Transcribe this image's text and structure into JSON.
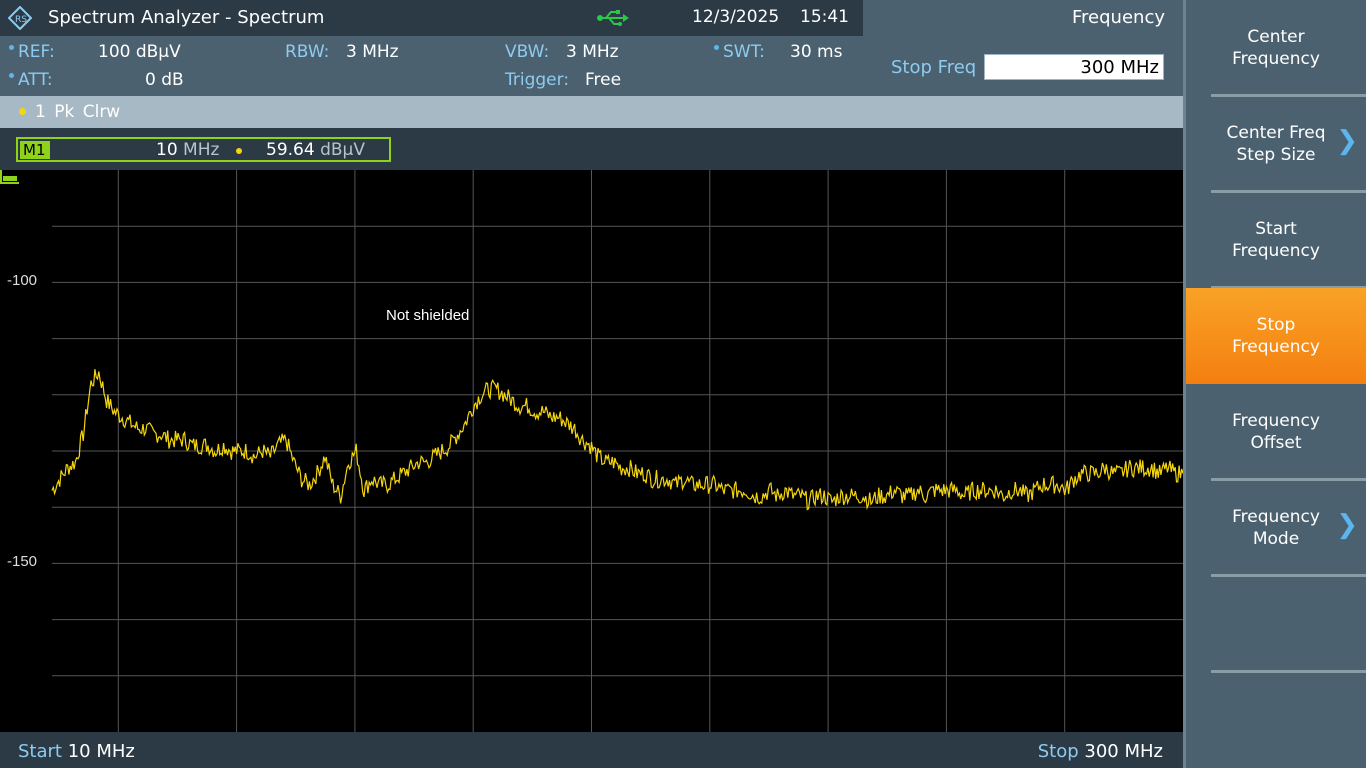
{
  "window": {
    "title": "Spectrum Analyzer - Spectrum",
    "date": "12/3/2025",
    "time": "15:41",
    "logo_icon": "rohde-schwarz-logo",
    "usb_icon": "usb-icon"
  },
  "params": {
    "ref_label": "REF:",
    "ref_value": "100 dBµV",
    "att_label": "ATT:",
    "att_value": "0 dB",
    "rbw_label": "RBW:",
    "rbw_value": "3 MHz",
    "vbw_label": "VBW:",
    "vbw_value": "3 MHz",
    "trigger_label": "Trigger:",
    "trigger_value": "Free",
    "swt_label": "SWT:",
    "swt_value": "30 ms"
  },
  "freq_panel": {
    "title": "Frequency",
    "field_label": "Stop Freq",
    "field_value": "300 MHz"
  },
  "trace": {
    "label": "1 Pk  Clrw",
    "color": "#f5d60a"
  },
  "marker": {
    "tag": "M1",
    "x_value": "10",
    "x_unit": "MHz",
    "y_value": "59.64",
    "y_unit": "dBµV",
    "color": "#8fd21a"
  },
  "plot": {
    "annotation": "Not shielded",
    "y_ticks": [
      "-100",
      "-150"
    ]
  },
  "status": {
    "start_label": "Start",
    "start_value": "10 MHz",
    "stop_label": "Stop",
    "stop_value": "300 MHz"
  },
  "softkeys": [
    {
      "label": "Center\nFrequency",
      "chevron": false,
      "active": false
    },
    {
      "label": "Center Freq\nStep Size",
      "chevron": true,
      "active": false
    },
    {
      "label": "Start\nFrequency",
      "chevron": false,
      "active": false
    },
    {
      "label": "Stop\nFrequency",
      "chevron": false,
      "active": true
    },
    {
      "label": "Frequency\nOffset",
      "chevron": false,
      "active": false
    },
    {
      "label": "Frequency\nMode",
      "chevron": true,
      "active": false
    }
  ],
  "chart_data": {
    "type": "line",
    "x_unit": "MHz",
    "xlim": [
      10,
      300
    ],
    "ylim": [
      -180,
      -80
    ],
    "y_unit": "dBµV",
    "y_ticks": [
      -100,
      -150
    ],
    "series": [
      {
        "color": "#f5d60a",
        "x": [
          10,
          12,
          14,
          16,
          18,
          20,
          22,
          24,
          26,
          28,
          30,
          32,
          34,
          36,
          38,
          40,
          42,
          44,
          46,
          48,
          50,
          52,
          54,
          56,
          58,
          60,
          62,
          64,
          66,
          68,
          70,
          72,
          74,
          76,
          78,
          80,
          82,
          84,
          86,
          88,
          90,
          92,
          94,
          96,
          98,
          100,
          102,
          104,
          106,
          108,
          110,
          112,
          114,
          116,
          118,
          120,
          122,
          124,
          126,
          128,
          130,
          132,
          134,
          136,
          138,
          140,
          142,
          144,
          146,
          148,
          150,
          152,
          154,
          156,
          158,
          160,
          162,
          164,
          166,
          168,
          170,
          172,
          174,
          176,
          178,
          180,
          182,
          184,
          186,
          188,
          190,
          192,
          194,
          196,
          198,
          200,
          202,
          204,
          206,
          208,
          210,
          212,
          214,
          216,
          218,
          220,
          222,
          224,
          226,
          228,
          230,
          232,
          234,
          236,
          238,
          240,
          242,
          244,
          246,
          248,
          250,
          252,
          254,
          256,
          258,
          260,
          262,
          264,
          266,
          268,
          270,
          272,
          274,
          276,
          278,
          280,
          282,
          284,
          286,
          288,
          290,
          292,
          294,
          296,
          298,
          300
        ],
        "y": [
          -137,
          -135,
          -133,
          -132,
          -127,
          -118,
          -116,
          -121,
          -123,
          -124,
          -125,
          -126,
          -126,
          -127,
          -127,
          -128,
          -128,
          -128,
          -129,
          -129,
          -129,
          -130,
          -129,
          -130,
          -130,
          -130,
          -131,
          -130,
          -131,
          -129,
          -128,
          -132,
          -135,
          -136,
          -134,
          -131,
          -136,
          -138,
          -132,
          -130,
          -137,
          -135,
          -136,
          -136,
          -135,
          -134,
          -133,
          -132,
          -132,
          -131,
          -130,
          -129,
          -127,
          -125,
          -122,
          -120,
          -119,
          -119,
          -120,
          -121,
          -122,
          -122,
          -123,
          -123,
          -124,
          -124,
          -125,
          -126,
          -128,
          -129,
          -131,
          -132,
          -132,
          -133,
          -133,
          -134,
          -134,
          -135,
          -135,
          -135,
          -136,
          -135,
          -136,
          -136,
          -136,
          -136,
          -137,
          -137,
          -137,
          -137,
          -138,
          -138,
          -137,
          -138,
          -137,
          -138,
          -138,
          -139,
          -138,
          -138,
          -139,
          -138,
          -138,
          -138,
          -138,
          -139,
          -138,
          -138,
          -137,
          -138,
          -138,
          -137,
          -138,
          -137,
          -137,
          -137,
          -137,
          -138,
          -137,
          -137,
          -137,
          -137,
          -138,
          -137,
          -137,
          -138,
          -137,
          -136,
          -136,
          -136,
          -137,
          -135,
          -134,
          -134,
          -134,
          -133,
          -134,
          -134,
          -133,
          -133,
          -133,
          -133,
          -134,
          -133,
          -134,
          -134
        ]
      }
    ]
  }
}
